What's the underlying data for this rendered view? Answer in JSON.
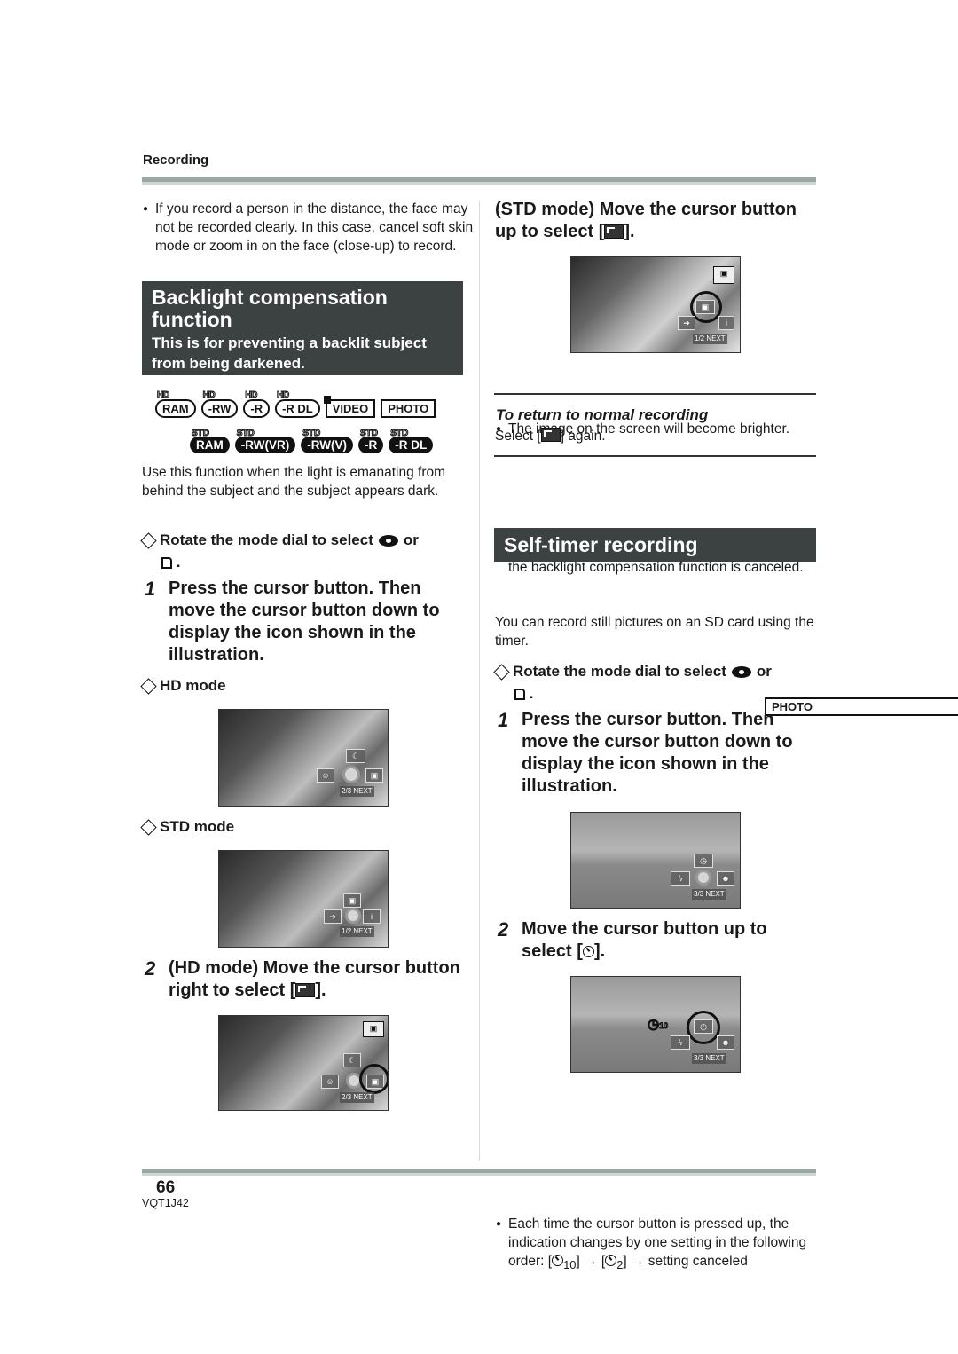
{
  "header": {
    "section": "Recording"
  },
  "left": {
    "intro_bullet": "If you record a person in the distance, the face may not be recorded clearly. In this case, cancel soft skin mode or zoom in on the face (close-up) to record.",
    "section_title": "Backlight compensation function",
    "section_subtitle": "This is for preventing a backlit subject from being darkened.",
    "hd_badges": [
      {
        "tag": "HD",
        "label": "RAM"
      },
      {
        "tag": "HD",
        "label": "-RW"
      },
      {
        "tag": "HD",
        "label": "-R"
      },
      {
        "tag": "HD",
        "label": "-R DL"
      }
    ],
    "box_badges": [
      "VIDEO",
      "PHOTO"
    ],
    "std_badges": [
      {
        "tag": "STD",
        "label": "RAM"
      },
      {
        "tag": "STD",
        "label": "-RW(VR)"
      },
      {
        "tag": "STD",
        "label": "-RW(V)"
      },
      {
        "tag": "STD",
        "label": "-R"
      },
      {
        "tag": "STD",
        "label": "-R DL"
      }
    ],
    "description": "Use this function when the light is emanating from behind the subject and the subject appears dark.",
    "rotate_instruction": "Rotate the mode dial to select",
    "rotate_or": "or",
    "rotate_end": ".",
    "step1_num": "1",
    "step1_text": "Press the cursor button. Then move the cursor button down to display the icon shown in the illustration.",
    "hd_mode_label": "HD mode",
    "hd_screen": {
      "page_indicator": "2/3 NEXT"
    },
    "std_mode_label": "STD mode",
    "std_screen": {
      "page_indicator": "1/2 NEXT"
    },
    "step2_num": "2",
    "step2_text_before": "(HD mode) Move the cursor button right to select [",
    "step2_text_after": "].",
    "step2_screen": {
      "page_indicator": "2/3 NEXT"
    }
  },
  "right": {
    "std_step_before": "(STD mode) Move the cursor button up to select [",
    "std_step_after": "].",
    "std_screen": {
      "page_indicator": "1/2 NEXT"
    },
    "brighter_bullet": "The image on the screen will become brighter.",
    "return_heading": "To return to normal recording",
    "return_before": "Select [",
    "return_after": "] again.",
    "cancel_bullet": "If you turn off the power or operate the mode dial, the backlight compensation function is canceled.",
    "selftimer_title": "Self-timer recording",
    "photo_badge": "PHOTO",
    "selftimer_desc": "You can record still pictures on an SD card using the timer.",
    "rotate_instruction": "Rotate the mode dial to select",
    "rotate_or": "or",
    "rotate_end": ".",
    "step1_num": "1",
    "step1_text": "Press the cursor button. Then move the cursor button down to display the icon shown in the illustration.",
    "step1_screen": {
      "page_indicator": "3/3 NEXT"
    },
    "step2_num": "2",
    "step2_before": "Move the cursor button up to select [",
    "step2_after": "].",
    "step2_screen": {
      "page_indicator": "3/3 NEXT",
      "timer_value": "10"
    },
    "order_bullet_1": "Each time the cursor button is pressed up, the indication changes by one setting in the following order: [",
    "order_sub1": "10",
    "order_mid": "] → [",
    "order_sub2": "2",
    "order_end": "] → setting canceled"
  },
  "footer": {
    "page_number": "66",
    "doc_code": "VQT1J42"
  }
}
